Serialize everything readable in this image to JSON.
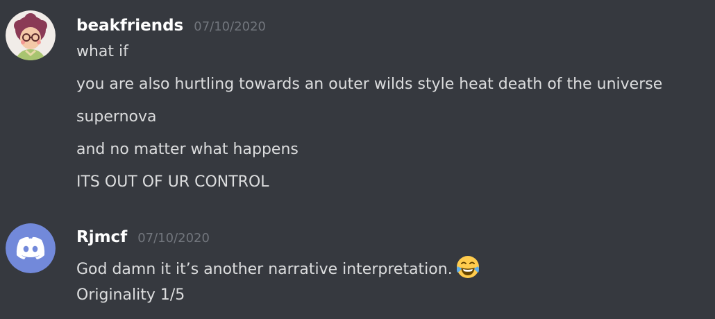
{
  "messages": [
    {
      "username": "beakfriends",
      "timestamp": "07/10/2020",
      "avatar_icon": "cartoon-person-avatar-icon",
      "lines": [
        "what if",
        "you are also hurtling towards an outer wilds style heat death of the universe",
        "supernova",
        "and no matter what happens",
        "ITS OUT OF UR CONTROL"
      ]
    },
    {
      "username": "Rjmcf",
      "timestamp": "07/10/2020",
      "avatar_icon": "discord-default-avatar-icon",
      "lines": [
        "God damn it it’s another narrative interpretation.",
        "Originality 1/5"
      ],
      "emoji": "face-with-tears-of-joy-icon"
    }
  ],
  "colors": {
    "background": "#36393f",
    "username": "#ffffff",
    "timestamp": "#72767d",
    "message_text": "#dcddde",
    "discord_blurple": "#7289da"
  }
}
